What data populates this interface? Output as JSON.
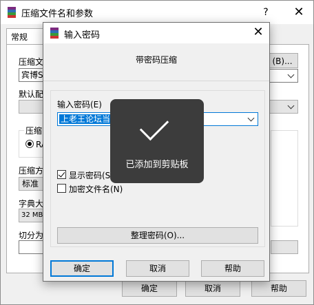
{
  "back_window": {
    "title": "压缩文件名和参数",
    "help_label": "?",
    "close_label": "✕",
    "tab_general": "常规",
    "archive_name_label": "压缩文",
    "archive_name_value": "宾博S",
    "browse_label": "(B)...",
    "default_config_label": "默认配",
    "format_group_label": "压缩",
    "format_radio_label": "RA",
    "method_label": "压缩方",
    "method_value": "标准",
    "dict_label": "字典大",
    "dict_value": "32 MB",
    "split_label": "切分为",
    "ok_label": "确定",
    "cancel_label": "取消",
    "help_button_label": "帮助"
  },
  "dialog": {
    "title": "输入密码",
    "close_label": "✕",
    "heading": "带密码压缩",
    "password_label": "输入密码(E)",
    "password_value": "上老王论坛当",
    "show_password_label": "显示密码(S)",
    "show_password_checked": true,
    "encrypt_names_label": "加密文件名(N)",
    "encrypt_names_checked": false,
    "organize_label": "整理密码(O)...",
    "ok_label": "确定",
    "cancel_label": "取消",
    "help_label": "帮助"
  },
  "toast": {
    "text": "已添加到剪贴板"
  },
  "icons": {
    "app": "winrar-icon",
    "check": "checkmark-icon"
  }
}
